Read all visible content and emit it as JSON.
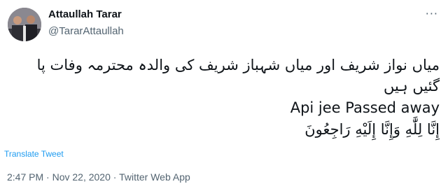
{
  "author": {
    "display_name": "Attaullah Tarar",
    "handle": "@TararAttaullah"
  },
  "more_icon": "more-horizontal-icon",
  "tweet": {
    "urdu_text": "میاں نواز شریف اور میاں شہباز شریف کی والدہ محترمہ وفات پا گئیں ہیں",
    "english_text": "Api jee Passed away",
    "arabic_text": "إِنَّا لِلَّٰهِ وَإِنَّا إِلَيْهِ رَاجِعُونَ"
  },
  "translate_label": "Translate Tweet",
  "meta": {
    "time": "2:47 PM",
    "separator": "·",
    "date": "Nov 22, 2020",
    "source": "Twitter Web App"
  }
}
